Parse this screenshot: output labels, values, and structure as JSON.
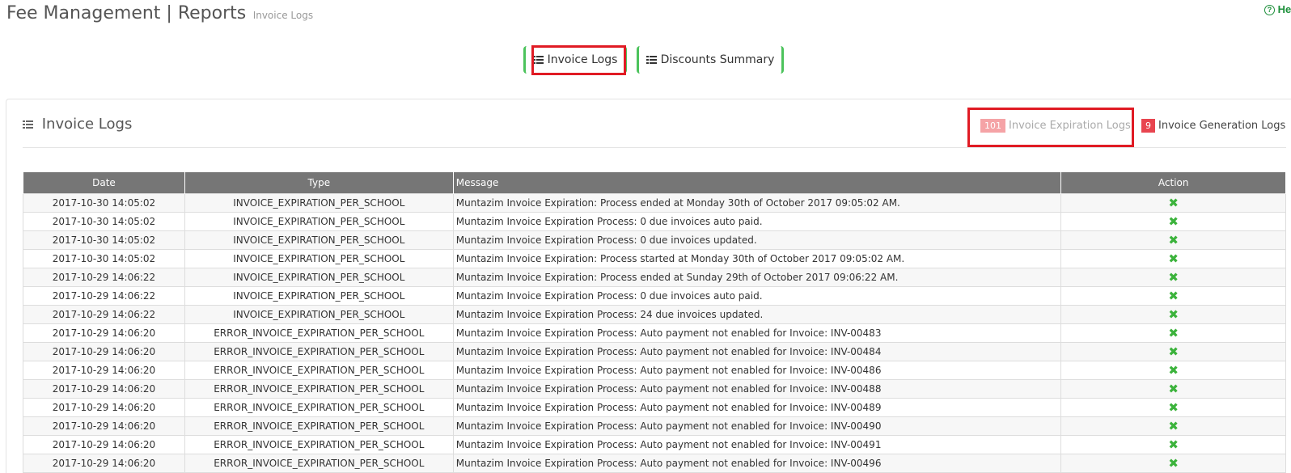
{
  "header": {
    "title": "Fee Management | Reports",
    "subtitle": "Invoice Logs",
    "help_label": "He"
  },
  "tabs": [
    {
      "label": "Invoice Logs",
      "icon": "list-icon",
      "active": true
    },
    {
      "label": "Discounts Summary",
      "icon": "list-icon",
      "active": false
    }
  ],
  "panel": {
    "title": "Invoice Logs",
    "links": {
      "expiration": {
        "count": "101",
        "label": "Invoice Expiration Logs"
      },
      "generation": {
        "count": "9",
        "label": "Invoice Generation Logs"
      }
    }
  },
  "table": {
    "columns": [
      "Date",
      "Type",
      "Message",
      "Action"
    ],
    "rows": [
      {
        "date": "2017-10-30 14:05:02",
        "type": "INVOICE_EXPIRATION_PER_SCHOOL",
        "message": "Muntazim Invoice Expiration: Process ended at Monday 30th of October 2017 09:05:02 AM."
      },
      {
        "date": "2017-10-30 14:05:02",
        "type": "INVOICE_EXPIRATION_PER_SCHOOL",
        "message": "Muntazim Invoice Expiration Process: 0 due invoices auto paid."
      },
      {
        "date": "2017-10-30 14:05:02",
        "type": "INVOICE_EXPIRATION_PER_SCHOOL",
        "message": "Muntazim Invoice Expiration Process: 0 due invoices updated."
      },
      {
        "date": "2017-10-30 14:05:02",
        "type": "INVOICE_EXPIRATION_PER_SCHOOL",
        "message": "Muntazim Invoice Expiration: Process started at Monday 30th of October 2017 09:05:02 AM."
      },
      {
        "date": "2017-10-29 14:06:22",
        "type": "INVOICE_EXPIRATION_PER_SCHOOL",
        "message": "Muntazim Invoice Expiration: Process ended at Sunday 29th of October 2017 09:06:22 AM."
      },
      {
        "date": "2017-10-29 14:06:22",
        "type": "INVOICE_EXPIRATION_PER_SCHOOL",
        "message": "Muntazim Invoice Expiration Process: 0 due invoices auto paid."
      },
      {
        "date": "2017-10-29 14:06:22",
        "type": "INVOICE_EXPIRATION_PER_SCHOOL",
        "message": "Muntazim Invoice Expiration Process: 24 due invoices updated."
      },
      {
        "date": "2017-10-29 14:06:20",
        "type": "ERROR_INVOICE_EXPIRATION_PER_SCHOOL",
        "message": "Muntazim Invoice Expiration Process: Auto payment not enabled for Invoice: INV-00483"
      },
      {
        "date": "2017-10-29 14:06:20",
        "type": "ERROR_INVOICE_EXPIRATION_PER_SCHOOL",
        "message": "Muntazim Invoice Expiration Process: Auto payment not enabled for Invoice: INV-00484"
      },
      {
        "date": "2017-10-29 14:06:20",
        "type": "ERROR_INVOICE_EXPIRATION_PER_SCHOOL",
        "message": "Muntazim Invoice Expiration Process: Auto payment not enabled for Invoice: INV-00486"
      },
      {
        "date": "2017-10-29 14:06:20",
        "type": "ERROR_INVOICE_EXPIRATION_PER_SCHOOL",
        "message": "Muntazim Invoice Expiration Process: Auto payment not enabled for Invoice: INV-00488"
      },
      {
        "date": "2017-10-29 14:06:20",
        "type": "ERROR_INVOICE_EXPIRATION_PER_SCHOOL",
        "message": "Muntazim Invoice Expiration Process: Auto payment not enabled for Invoice: INV-00489"
      },
      {
        "date": "2017-10-29 14:06:20",
        "type": "ERROR_INVOICE_EXPIRATION_PER_SCHOOL",
        "message": "Muntazim Invoice Expiration Process: Auto payment not enabled for Invoice: INV-00490"
      },
      {
        "date": "2017-10-29 14:06:20",
        "type": "ERROR_INVOICE_EXPIRATION_PER_SCHOOL",
        "message": "Muntazim Invoice Expiration Process: Auto payment not enabled for Invoice: INV-00491"
      },
      {
        "date": "2017-10-29 14:06:20",
        "type": "ERROR_INVOICE_EXPIRATION_PER_SCHOOL",
        "message": "Muntazim Invoice Expiration Process: Auto payment not enabled for Invoice: INV-00496"
      }
    ],
    "action_icon": "delete-x-icon"
  },
  "colors": {
    "accent_green": "#4cc35c",
    "highlight_red": "#e01b24",
    "header_gray": "#767676",
    "badge_light_red": "#f5a3a6",
    "badge_red": "#e8454f"
  }
}
